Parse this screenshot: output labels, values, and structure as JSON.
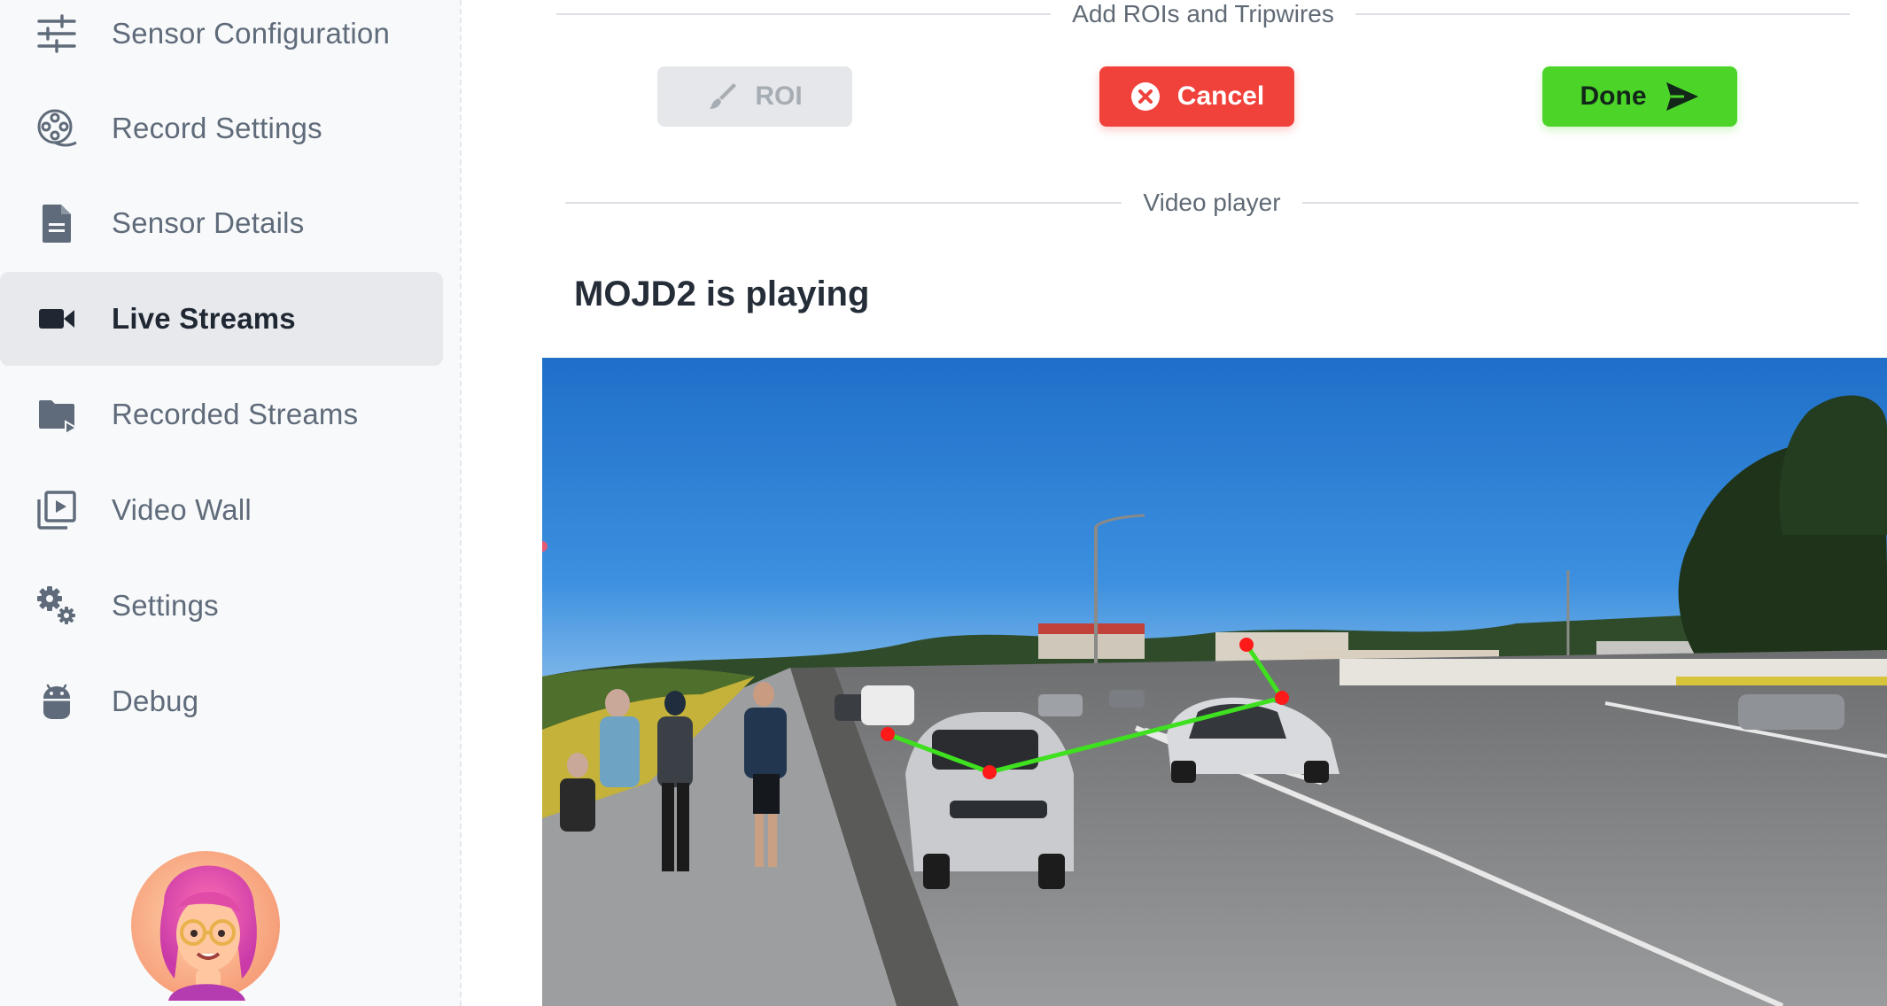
{
  "sidebar": {
    "items": [
      {
        "label": "Sensor Configuration",
        "icon": "sliders-icon"
      },
      {
        "label": "Record Settings",
        "icon": "film-reel-icon"
      },
      {
        "label": "Sensor Details",
        "icon": "document-icon"
      },
      {
        "label": "Live Streams",
        "icon": "video-camera-icon",
        "active": true
      },
      {
        "label": "Recorded Streams",
        "icon": "folder-play-icon"
      },
      {
        "label": "Video Wall",
        "icon": "video-library-icon"
      },
      {
        "label": "Settings",
        "icon": "gears-icon"
      },
      {
        "label": "Debug",
        "icon": "android-icon"
      }
    ]
  },
  "roi_section": {
    "title": "Add ROIs and Tripwires",
    "roi_label": "ROI",
    "cancel_label": "Cancel",
    "done_label": "Done"
  },
  "player_section": {
    "title": "Video player",
    "playing_text": "MOJD2 is playing"
  },
  "colors": {
    "accent_cancel": "#f0413b",
    "accent_done": "#4cd429",
    "tripwire": "#3ee01f",
    "tripwire_node": "#ff1a1a"
  }
}
